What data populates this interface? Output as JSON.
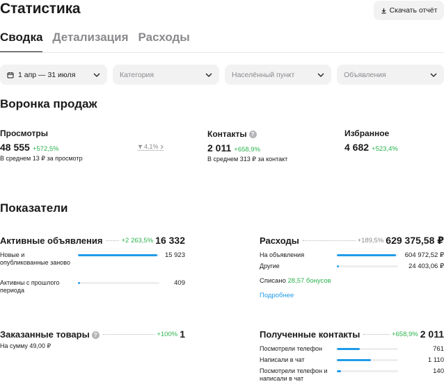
{
  "header": {
    "title": "Статистика",
    "download_label": "Скачать отчёт"
  },
  "tabs": [
    {
      "label": "Сводка",
      "active": true
    },
    {
      "label": "Детализация",
      "active": false
    },
    {
      "label": "Расходы",
      "active": false
    }
  ],
  "filters": {
    "period": "1 апр — 31 июля",
    "category_placeholder": "Категория",
    "city_placeholder": "Населённый пункт",
    "ads_placeholder": "Объявления"
  },
  "funnel": {
    "title": "Воронка продаж",
    "views": {
      "label": "Просмотры",
      "value": "48 555",
      "delta": "+572,5%",
      "note": "В среднем 13 ₽ за просмотр"
    },
    "conversion": {
      "label": "4,1%"
    },
    "contacts": {
      "label": "Контакты",
      "value": "2 011",
      "delta": "+658,9%",
      "note": "В среднем 313 ₽ за контакт"
    },
    "favorites": {
      "label": "Избранное",
      "value": "4 682",
      "delta": "+523,4%"
    }
  },
  "indicators": {
    "title": "Показатели",
    "active_ads": {
      "title": "Активные объявления",
      "delta": "+2 263,5%",
      "value": "16 332",
      "rows": [
        {
          "label": "Новые и опубликованные заново",
          "value": "15 923",
          "fill": 0.975
        },
        {
          "label": "Активны с прошлого периода",
          "value": "409",
          "fill": 0.025
        }
      ]
    },
    "expenses": {
      "title": "Расходы",
      "delta": "+189,5%",
      "value": "629 375,58 ₽",
      "rows": [
        {
          "label": "На объявления",
          "value": "604 972,52 ₽",
          "fill": 0.961
        },
        {
          "label": "Другие",
          "value": "24 403,06 ₽",
          "fill": 0.039
        }
      ],
      "bonus_prefix": "Списано",
      "bonus_amount": "28,57 бонусов",
      "more_link": "Подробнее"
    },
    "ordered": {
      "title": "Заказанные товары",
      "delta": "+100%",
      "value": "1",
      "note": "На сумму 49,00 ₽"
    },
    "received_contacts": {
      "title": "Полученные контакты",
      "delta": "+658,9%",
      "value": "2 011",
      "rows": [
        {
          "label": "Посмотрели телефон",
          "value": "761",
          "fill": 0.378
        },
        {
          "label": "Написали в чат",
          "value": "1 110",
          "fill": 0.552
        },
        {
          "label": "Посмотрели телефон и написали в чат",
          "value": "140",
          "fill": 0.07
        }
      ]
    }
  },
  "colors": {
    "accent": "#1f9be8",
    "positive": "#2bb24c",
    "muted": "#8a8a8e",
    "surface": "#f2f2f3"
  }
}
